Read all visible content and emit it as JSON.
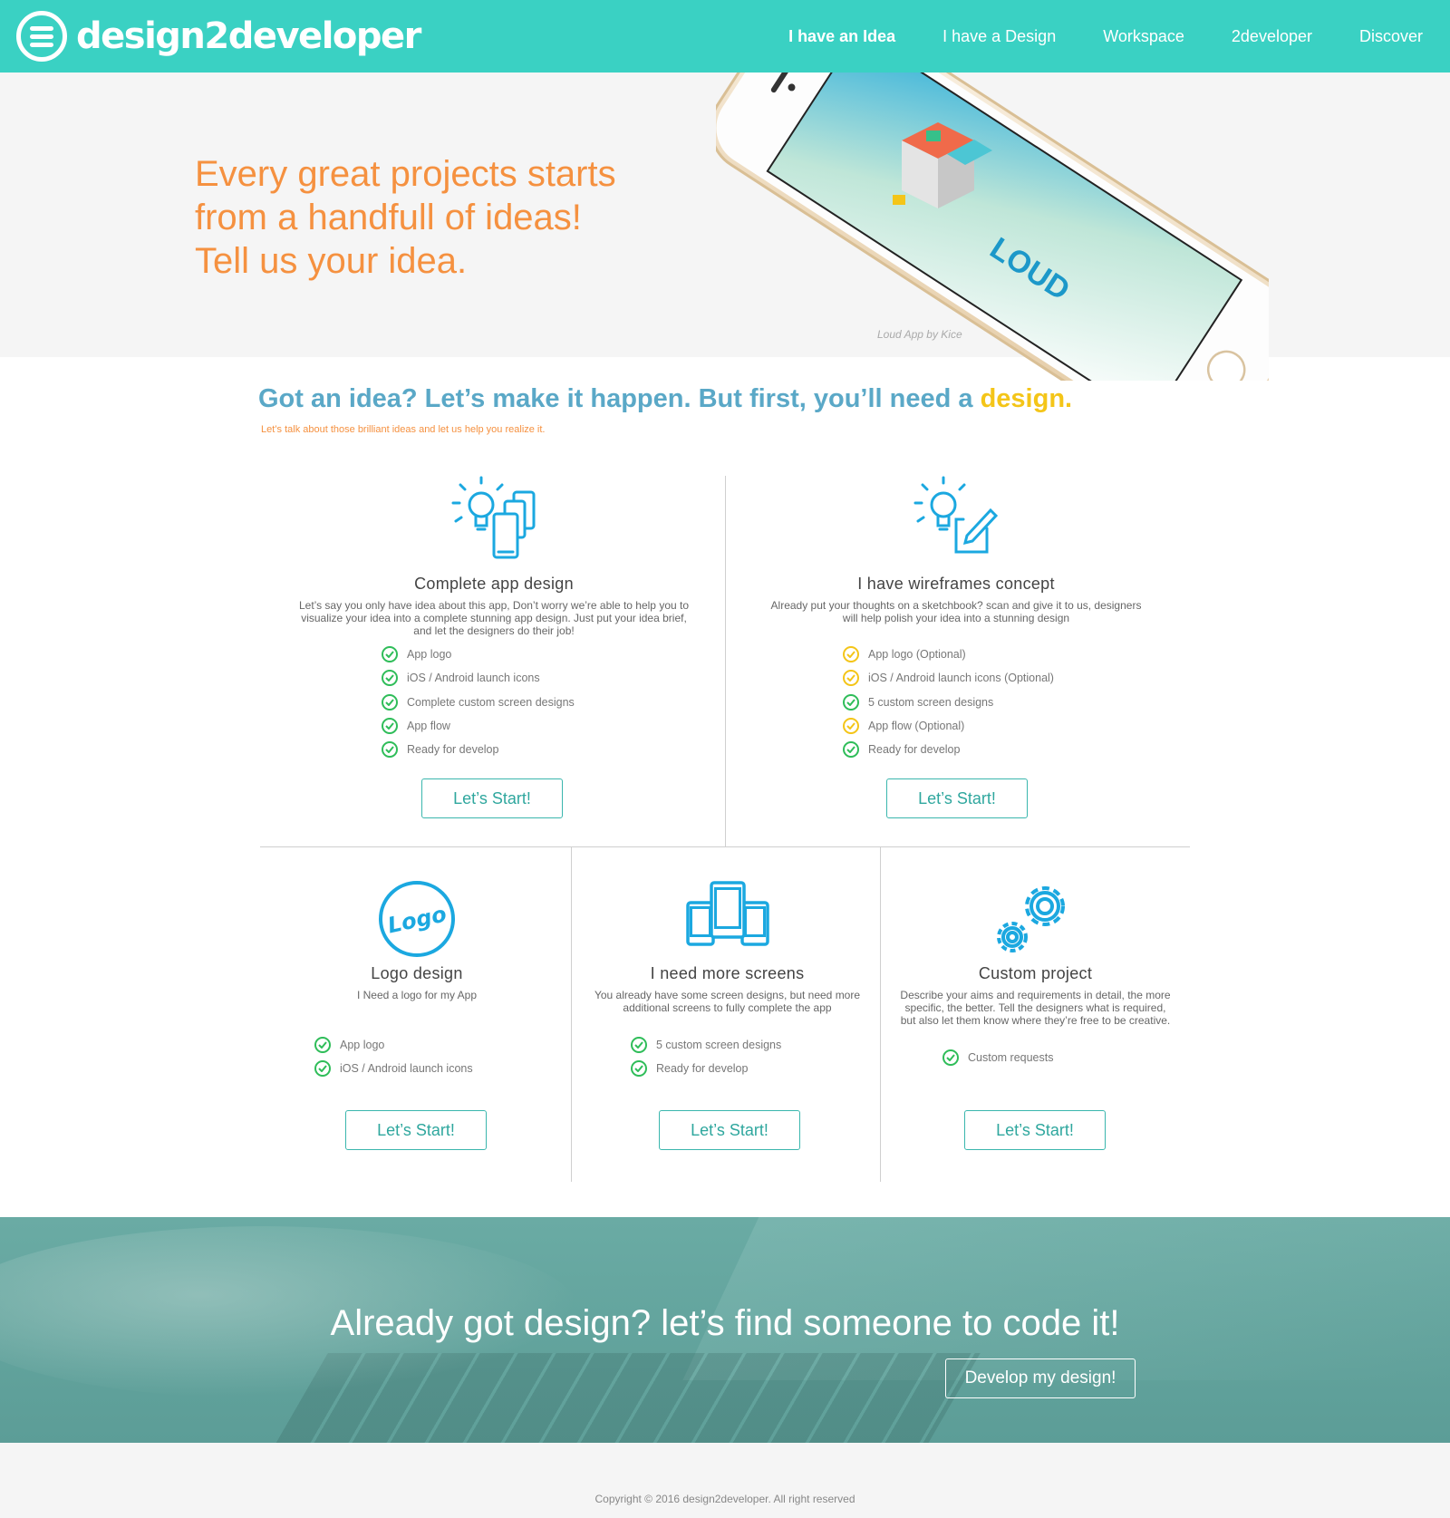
{
  "header": {
    "logo_text": "design2developer",
    "nav": [
      {
        "label": "I have an Idea",
        "active": true
      },
      {
        "label": "I have a Design",
        "active": false
      },
      {
        "label": "Workspace",
        "active": false
      },
      {
        "label": "2developer",
        "active": false
      },
      {
        "label": "Discover",
        "active": false
      }
    ]
  },
  "hero": {
    "headline_lines": [
      "Every great projects starts",
      "from a handfull of ideas!",
      "Tell us your idea."
    ],
    "app_name": "LOUD",
    "caption": "Loud App by Kice"
  },
  "section": {
    "title_main": "Got an idea? Let’s make it happen. But first, you’ll need a ",
    "title_accent": "design.",
    "subtitle": "Let’s talk about those brilliant ideas and let us help you realize it."
  },
  "cards": [
    {
      "icon": "lightbulb-screens-icon",
      "title": "Complete app design",
      "description": "Let’s say you only have idea about this app, Don’t worry we’re able to help you to visualize your idea into a complete stunning app design. Just put your idea brief, and let the designers do their job!",
      "features": [
        {
          "label": "App logo",
          "optional": false
        },
        {
          "label": "iOS / Android launch icons",
          "optional": false
        },
        {
          "label": "Complete custom screen designs",
          "optional": false
        },
        {
          "label": "App flow",
          "optional": false
        },
        {
          "label": "Ready for develop",
          "optional": false
        }
      ],
      "button": "Let’s Start!"
    },
    {
      "icon": "lightbulb-pencil-icon",
      "title": "I have wireframes concept",
      "description": "Already put your thoughts on a sketchbook? scan and give it to us, designers will help polish your idea into a stunning design",
      "features": [
        {
          "label": "App logo (Optional)",
          "optional": true
        },
        {
          "label": "iOS / Android launch icons (Optional)",
          "optional": true
        },
        {
          "label": "5 custom screen designs",
          "optional": false
        },
        {
          "label": "App flow (Optional)",
          "optional": true
        },
        {
          "label": "Ready for develop",
          "optional": false
        }
      ],
      "button": "Let’s Start!"
    },
    {
      "icon": "logo-badge-icon",
      "icon_text": "Logo",
      "title": "Logo design",
      "description": "I Need a logo for my App",
      "features": [
        {
          "label": "App logo",
          "optional": false
        },
        {
          "label": "iOS / Android launch icons",
          "optional": false
        }
      ],
      "button": "Let’s Start!"
    },
    {
      "icon": "devices-icon",
      "title": "I need more screens",
      "description": "You already have some screen designs, but need more additional screens to fully complete the app",
      "features": [
        {
          "label": "5 custom screen designs",
          "optional": false
        },
        {
          "label": "Ready for develop",
          "optional": false
        }
      ],
      "button": "Let’s Start!"
    },
    {
      "icon": "gears-icon",
      "title": "Custom project",
      "description": "Describe your aims and requirements in detail, the more specific, the better. Tell the designers what is required, but also let them know where they’re free to be creative.",
      "features": [
        {
          "label": "Custom requests",
          "optional": false
        }
      ],
      "button": "Let’s Start!"
    }
  ],
  "banner": {
    "text": "Already got design? let’s find someone to code it!",
    "button": "Develop my design!"
  },
  "footer": {
    "copyright": "Copyright ©  2016 design2developer. All right reserved"
  },
  "colors": {
    "brand": "#3ad1c3",
    "headline_orange": "#f59140",
    "title_blue": "#5aa8c7",
    "accent_yellow": "#f4c518",
    "check_green": "#2fbd59",
    "icon_blue": "#1ba8e0"
  }
}
